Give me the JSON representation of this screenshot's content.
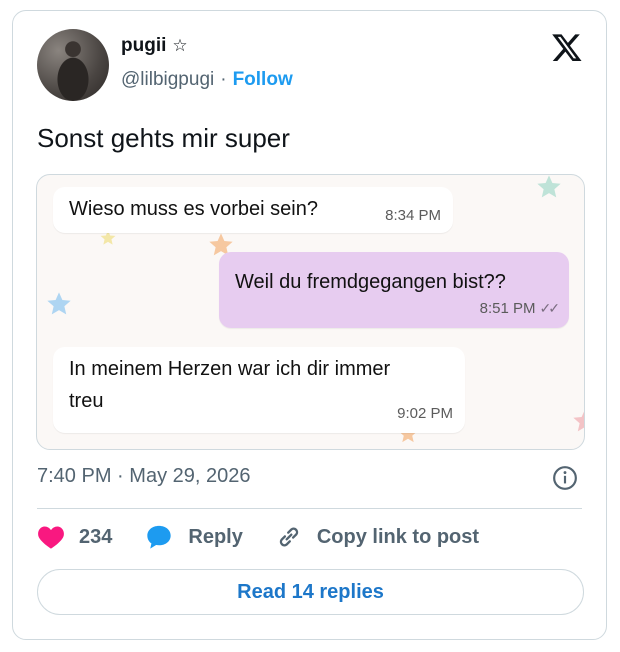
{
  "author": {
    "name": "pugii",
    "badge_icon": "star-outline-icon",
    "handle": "@lilbigpugi",
    "separator": "·",
    "follow_label": "Follow"
  },
  "tweet": {
    "text": "Sonst gehts mir super",
    "time": "7:40 PM",
    "date_separator": "·",
    "date": "May 29, 2026"
  },
  "chat": {
    "messages": [
      {
        "direction": "incoming",
        "text": "Wieso muss es vorbei sein?",
        "time": "8:34 PM"
      },
      {
        "direction": "outgoing",
        "text": "Weil du fremdgegangen bist??",
        "time": "8:51 PM",
        "status_icon": "double-check-icon"
      },
      {
        "direction": "incoming",
        "text_line1": "In meinem Herzen war ich dir immer",
        "text_line2": "treu",
        "time": "9:02 PM"
      }
    ]
  },
  "actions": {
    "like_count": "234",
    "reply_label": "Reply",
    "copy_label": "Copy link to post"
  },
  "read_replies_label": "Read 14 replies",
  "colors": {
    "accent": "#1d9bf0",
    "like": "#f91880",
    "outgoing_bubble": "#e7ccf0"
  }
}
